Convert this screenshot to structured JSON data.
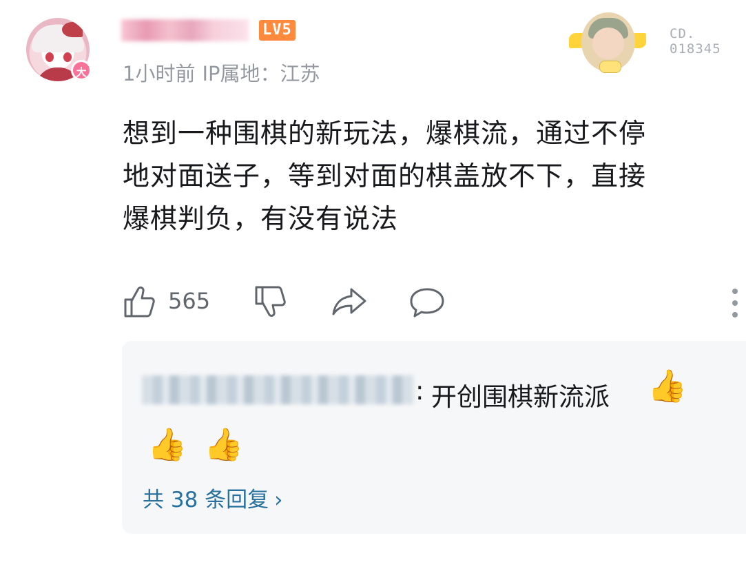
{
  "comment": {
    "username": "████████",
    "level": "LV5",
    "vip_badge": "大",
    "time": "1小时前",
    "ip_location": "IP属地：江苏",
    "decoration_number": "CD.\n018345",
    "text": "想到一种围棋的新玩法，爆棋流，通过不停\n地对面送子，等到对面的棋盖放不下，直接\n爆棋判负，有没有说法",
    "like_count": "565"
  },
  "reply": {
    "username": "███████████",
    "colon": ":",
    "text": "开创围棋新流派",
    "emoji": "👍",
    "count_text": "共 38 条回复",
    "chevron": "›"
  },
  "icons": {
    "like": "thumb-up-icon",
    "dislike": "thumb-down-icon",
    "share": "share-icon",
    "comment": "comment-icon",
    "more": "more-vertical-icon"
  },
  "colors": {
    "level_badge": "#ff8a3d",
    "vip_badge": "#fb7299",
    "link": "#28719f",
    "meta_text": "#9499a0"
  }
}
